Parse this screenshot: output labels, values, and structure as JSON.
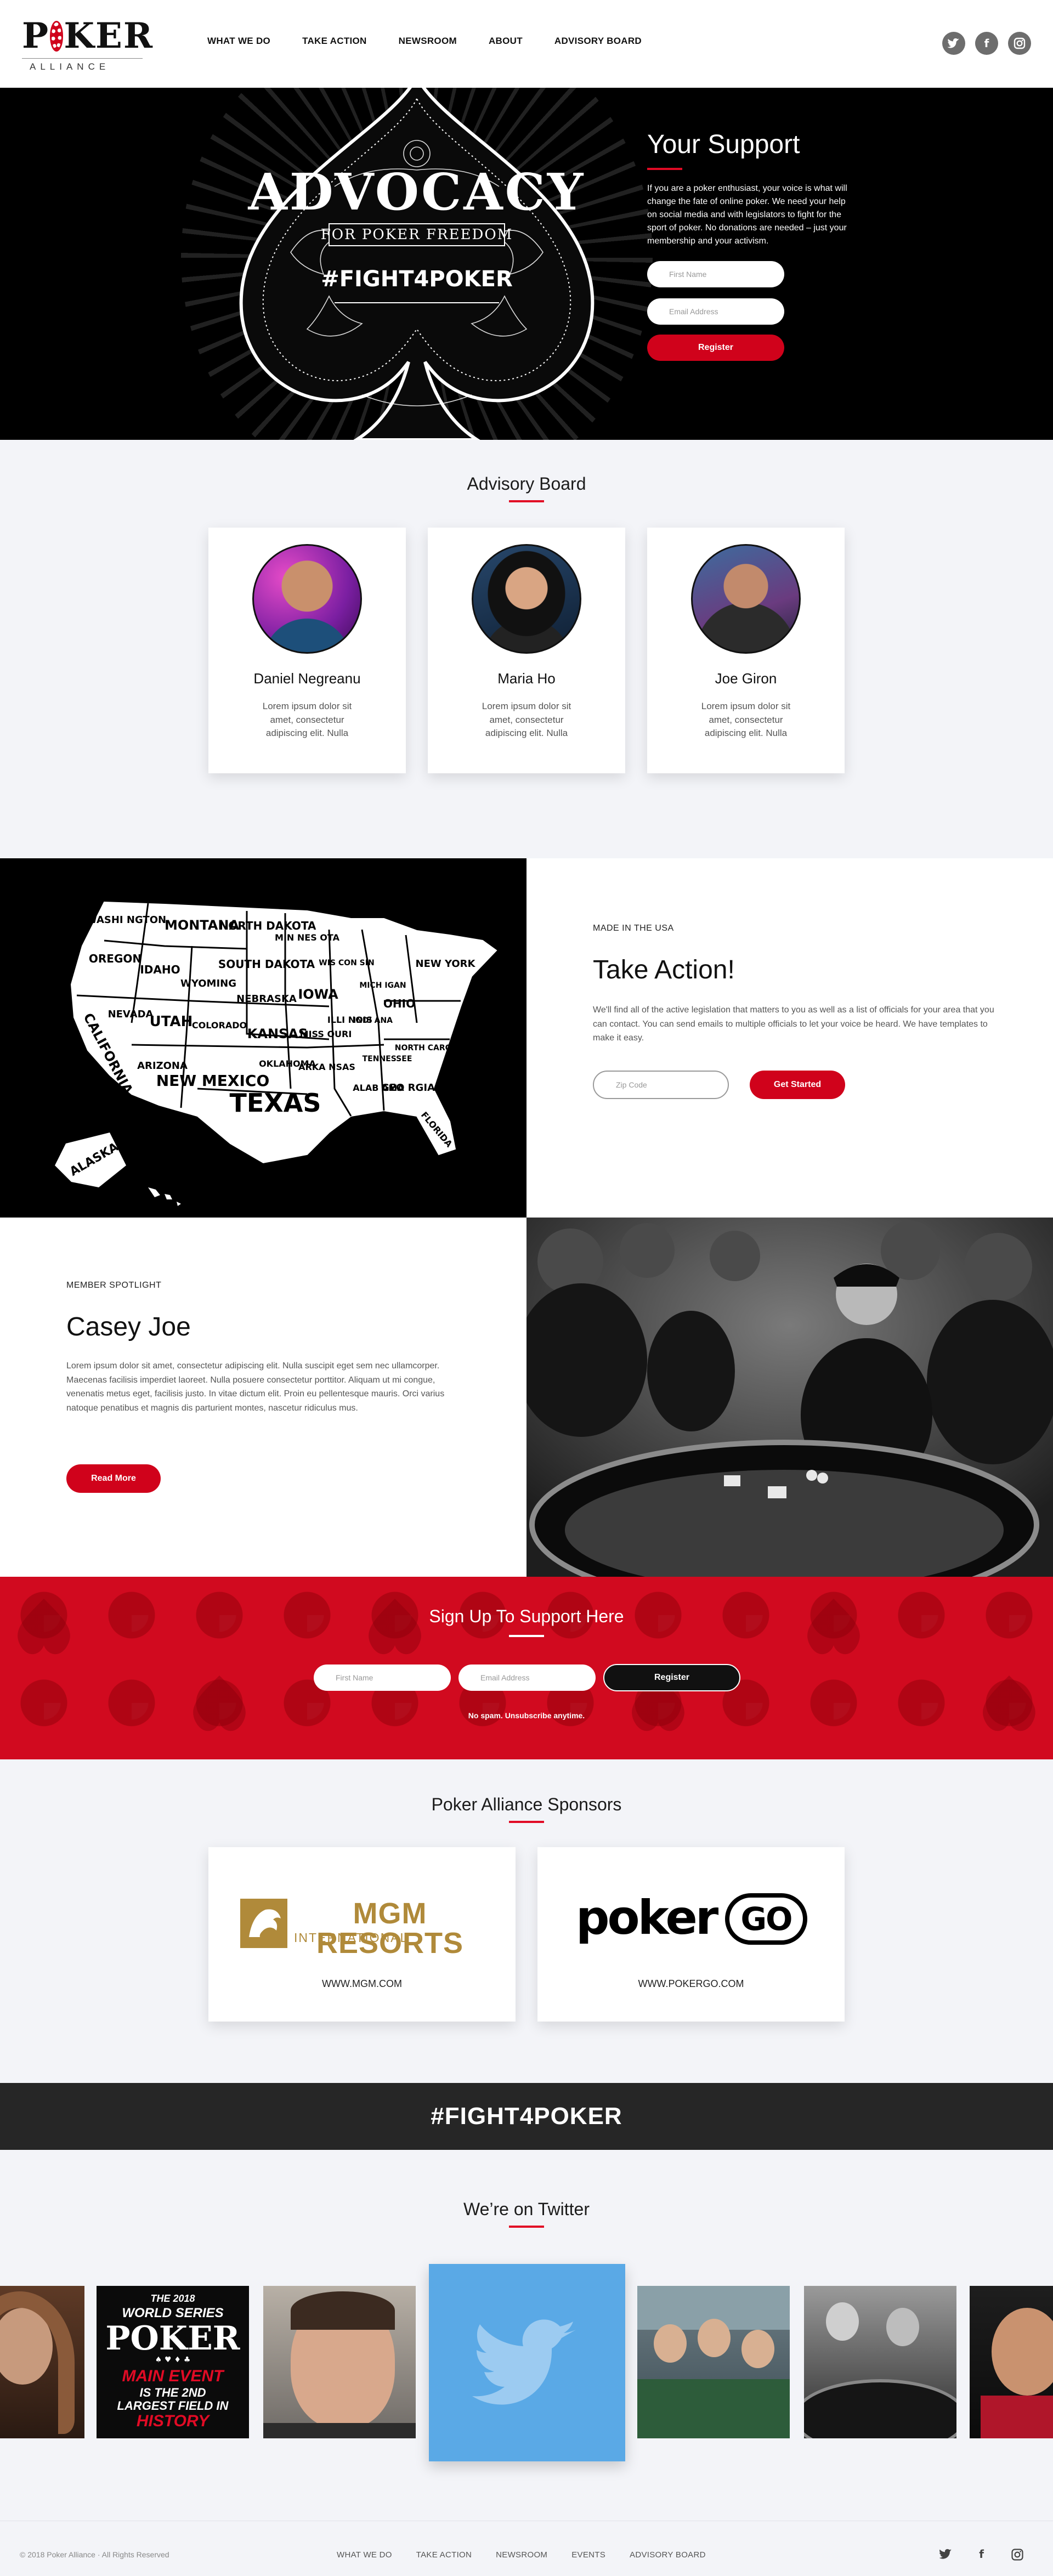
{
  "header": {
    "logo_word": "POKER",
    "logo_sub": "ALLIANCE",
    "nav": [
      "WHAT WE DO",
      "TAKE ACTION",
      "NEWSROOM",
      "ABOUT",
      "ADVISORY BOARD"
    ],
    "social_icons": [
      "twitter-icon",
      "facebook-icon",
      "instagram-icon"
    ]
  },
  "hero": {
    "art_title": "ADVOCACY",
    "art_subtitle": "FOR POKER FREEDOM",
    "art_tag": "#FIGHT4POKER",
    "title": "Your Support",
    "body": "If you are a poker enthusiast, your voice is what will change the fate of online poker. We need your help on social media and with legislators to fight for the sport of poker. No donations are needed – just your membership and your activism.",
    "first_name_placeholder": "First Name",
    "email_placeholder": "Email Address",
    "register_label": "Register"
  },
  "advisory": {
    "title": "Advisory Board",
    "members": [
      {
        "name": "Daniel Negreanu",
        "bio": "Lorem ipsum dolor sit amet, consectetur adipiscing elit. Nulla"
      },
      {
        "name": "Maria Ho",
        "bio": "Lorem ipsum dolor sit amet, consectetur adipiscing elit. Nulla"
      },
      {
        "name": "Joe Giron",
        "bio": "Lorem ipsum dolor sit amet, consectetur adipiscing elit. Nulla"
      }
    ]
  },
  "take_action": {
    "eyebrow": "MADE IN THE USA",
    "title": "Take Action!",
    "body": "We'll find all of the active legislation that matters to you as well as a list of officials for your area that you can contact. You can send emails to multiple officials to let your voice be heard. We have templates to make it easy.",
    "zip_placeholder": "Zip Code",
    "cta_label": "Get Started",
    "map_states": [
      "WASHI NGTON",
      "MONTANA",
      "NORTH DAKOTA",
      "MIN NES OTA",
      "OREGON",
      "IDAHO",
      "WYOMING",
      "SOUTH DAKOTA",
      "WIS CON SIN",
      "NEW YORK",
      "NEVADA",
      "UTAH",
      "COLORADO",
      "NEBRASKA",
      "IOWA",
      "MICH IGAN",
      "OHIO",
      "CALIFORNIA",
      "KANSAS",
      "MISS OURI",
      "ILLI NOIS",
      "INDI ANA",
      "ARIZONA",
      "NEW MEXICO",
      "OKLAHOMA",
      "ARKA NSAS",
      "TENNESSEE",
      "NORTH CAROLINA",
      "TEXAS",
      "ALAB AMA",
      "GEO RGIA",
      "FLORIDA",
      "ALASKA"
    ]
  },
  "spotlight": {
    "eyebrow": "MEMBER SPOTLIGHT",
    "name": "Casey Joe",
    "body": "Lorem ipsum dolor sit amet, consectetur adipiscing elit. Nulla suscipit eget sem nec ullamcorper. Maecenas facilisis imperdiet laoreet. Nulla posuere consectetur porttitor. Aliquam ut mi congue, venenatis metus eget, facilisis justo. In vitae dictum elit. Proin eu pellentesque mauris. Orci varius natoque penatibus et magnis dis parturient montes, nascetur ridiculus mus.",
    "cta_label": "Read More"
  },
  "signup": {
    "title": "Sign Up To Support Here",
    "first_name_placeholder": "First Name",
    "email_placeholder": "Email Address",
    "register_label": "Register",
    "fine_print": "No spam. Unsubscribe anytime."
  },
  "sponsors": {
    "title": "Poker Alliance Sponsors",
    "items": [
      {
        "logo_main": "MGM RESORTS",
        "logo_sub": "INTERNATIONAL",
        "url": "WWW.MGM.COM"
      },
      {
        "logo_main": "poker",
        "logo_sub": "GO",
        "url": "WWW.POKERGO.COM"
      }
    ]
  },
  "fight_banner": "#FIGHT4POKER",
  "twitter": {
    "title": "We’re on Twitter",
    "wsop_tile": [
      "THE 2018",
      "WORLD SERIES",
      "POKER",
      "MAIN EVENT",
      "IS THE 2ND",
      "LARGEST FIELD IN",
      "HISTORY"
    ]
  },
  "footer": {
    "copyright": "© 2018 Poker Alliance · All Rights Reserved",
    "nav": [
      "WHAT WE DO",
      "TAKE ACTION",
      "NEWSROOM",
      "EVENTS",
      "ADVISORY BOARD"
    ],
    "social_icons": [
      "twitter-icon",
      "facebook-icon",
      "instagram-icon"
    ]
  },
  "colors": {
    "accent": "#d0021b",
    "dark": "#262626",
    "light_bg": "#f3f4f8",
    "twitter_blue": "#5aa9e6"
  }
}
